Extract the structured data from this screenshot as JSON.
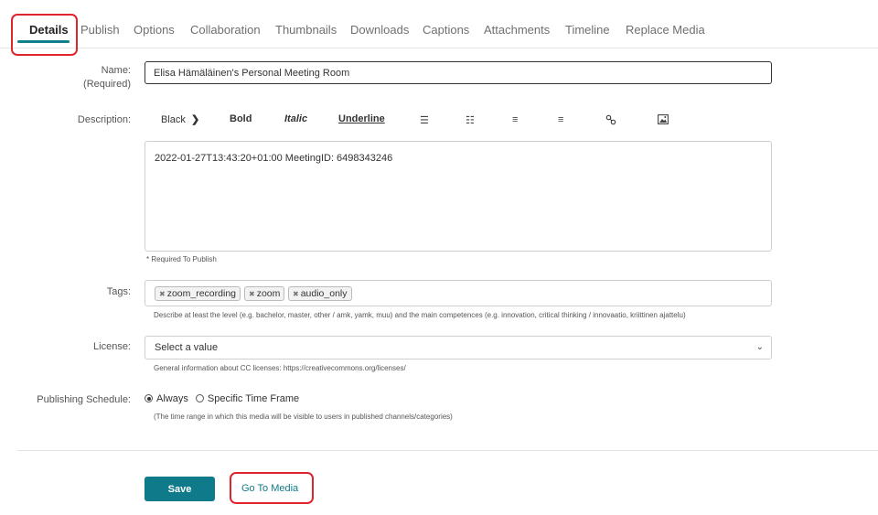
{
  "tabs": [
    {
      "label": "Details"
    },
    {
      "label": "Publish"
    },
    {
      "label": "Options"
    },
    {
      "label": "Collaboration"
    },
    {
      "label": "Thumbnails"
    },
    {
      "label": "Downloads"
    },
    {
      "label": "Captions"
    },
    {
      "label": "Attachments"
    },
    {
      "label": "Timeline"
    },
    {
      "label": "Replace Media"
    }
  ],
  "form": {
    "name_label": "Name:",
    "name_required": "(Required)",
    "name_value": "Elisa Hämäläinen's Personal Meeting Room",
    "description_label": "Description:",
    "toolbar": {
      "color": "Black",
      "bold": "Bold",
      "italic": "Italic",
      "underline": "Underline"
    },
    "description_value": "2022-01-27T13:43:20+01:00 MeetingID: 6498343246",
    "required_note": "* Required To Publish",
    "tags_label": "Tags:",
    "tags": [
      "zoom_recording",
      "zoom",
      "audio_only"
    ],
    "tags_help": "Describe at least the level (e.g. bachelor, master, other / amk, yamk, muu) and the main competences (e.g. innovation, critical thinking / innovaatio, kriittinen ajattelu)",
    "license_label": "License:",
    "license_value": "Select a value",
    "license_help": "General information about CC licenses: https://creativecommons.org/licenses/",
    "schedule_label": "Publishing Schedule:",
    "schedule_options": [
      "Always",
      "Specific Time Frame"
    ],
    "schedule_help": "(The time range in which this media will be visible to users in published channels/categories)"
  },
  "actions": {
    "save": "Save",
    "goto_media": "Go To Media"
  },
  "colors": {
    "accent": "#0f7b8a",
    "highlight": "#e0242e"
  }
}
